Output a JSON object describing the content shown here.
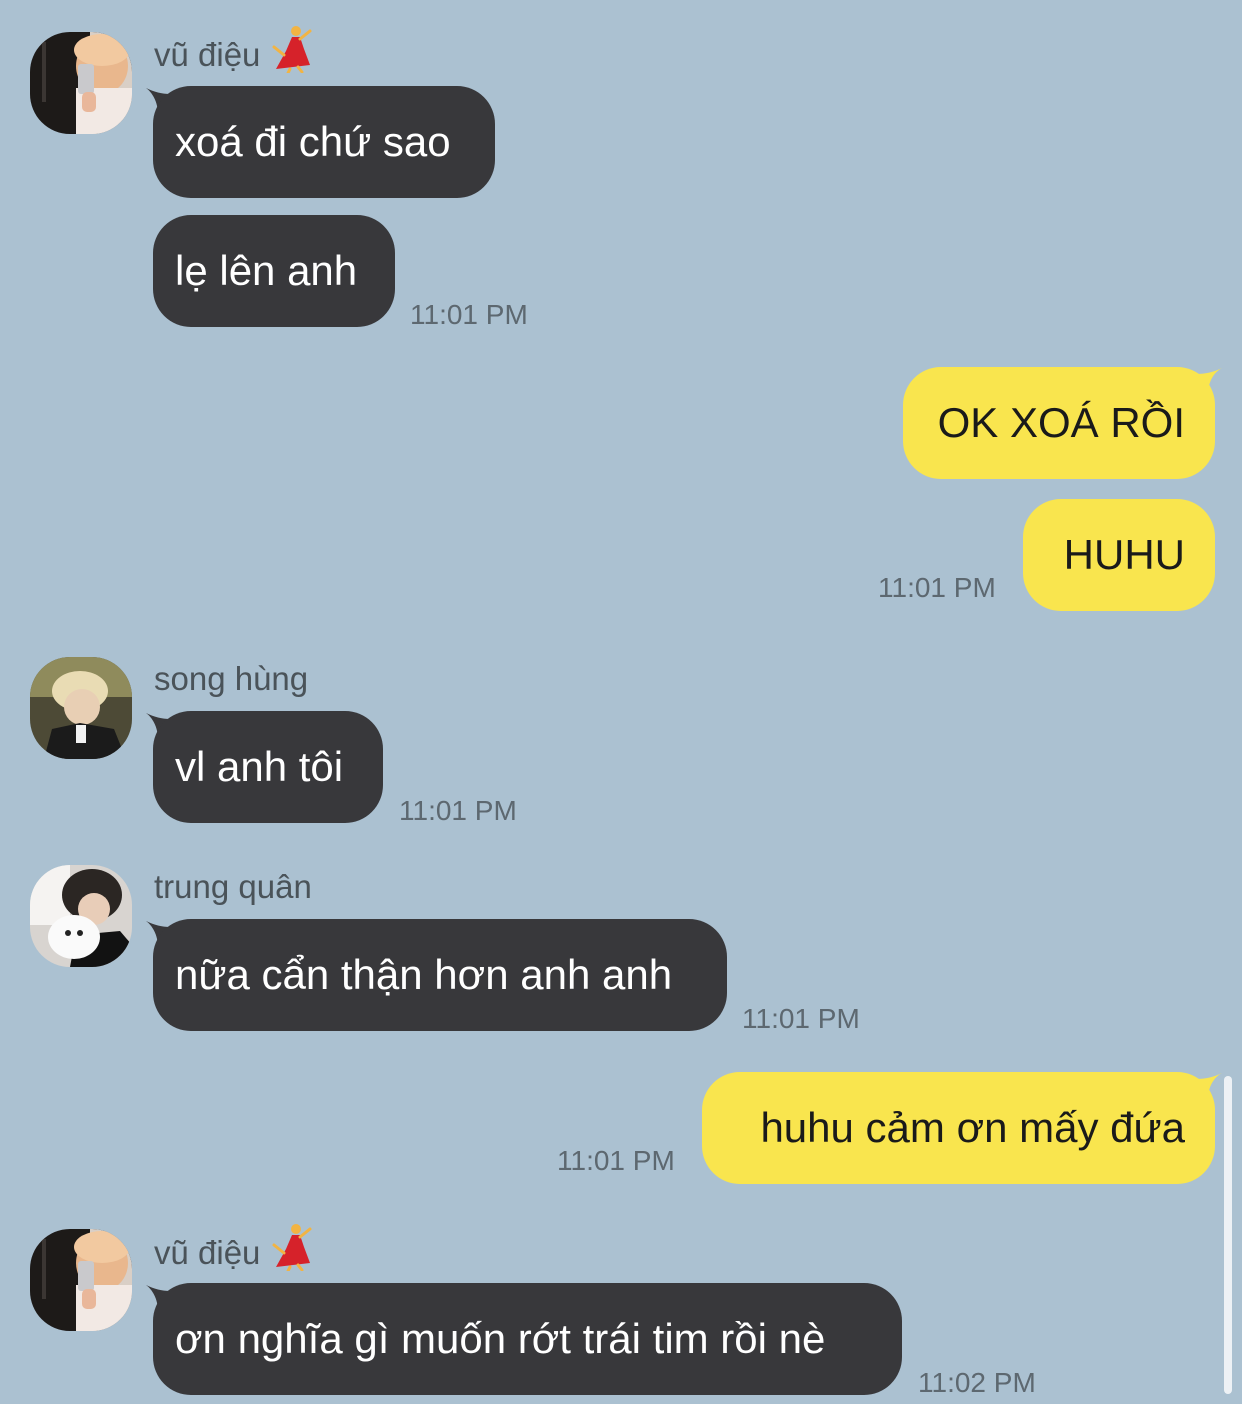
{
  "colors": {
    "background": "#abc1d1",
    "incoming_bubble": "#38383b",
    "outgoing_bubble": "#f9e54e",
    "timestamp": "#5d6870"
  },
  "messages": {
    "m1": {
      "sender": "vũ điệu",
      "sender_emoji": "dancer-emoji",
      "text": "xoá đi chứ sao"
    },
    "m2": {
      "text": "lẹ lên anh",
      "time": "11:01 PM"
    },
    "m3": {
      "text": "OK XOÁ RỒI"
    },
    "m4": {
      "text": "HUHU",
      "time": "11:01 PM"
    },
    "m5": {
      "sender": "song hùng",
      "text": "vl anh tôi",
      "time": "11:01 PM"
    },
    "m6": {
      "sender": "trung quân",
      "text": "nữa cẩn thận hơn anh anh",
      "time": "11:01 PM"
    },
    "m7": {
      "text": "huhu cảm ơn mấy đứa",
      "time": "11:01 PM"
    },
    "m8": {
      "sender": "vũ điệu",
      "sender_emoji": "dancer-emoji",
      "text": "ơn nghĩa gì muốn rớt trái tim rồi nè",
      "time": "11:02 PM"
    }
  }
}
